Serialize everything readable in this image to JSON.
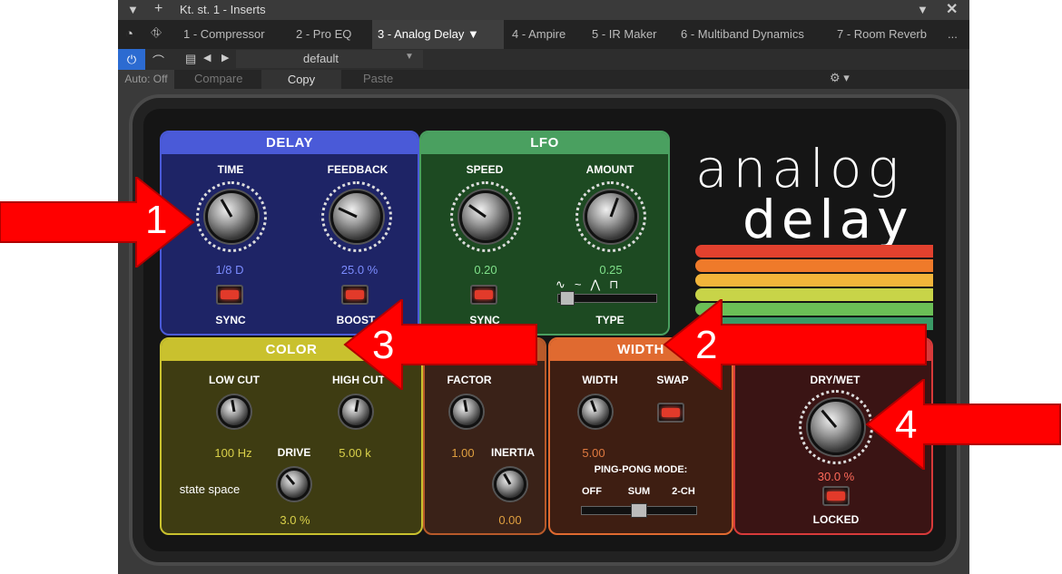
{
  "window": {
    "title": "Kt. st. 1 - Inserts"
  },
  "tabs": [
    {
      "label": "1 - Compressor"
    },
    {
      "label": "2 - Pro EQ"
    },
    {
      "label": "3 - Analog Delay"
    },
    {
      "label": "4 - Ampire"
    },
    {
      "label": "5 - IR Maker"
    },
    {
      "label": "6 - Multiband Dynamics"
    },
    {
      "label": "7 - Room Reverb"
    },
    {
      "label": "..."
    }
  ],
  "preset": {
    "name": "default"
  },
  "toolbar": {
    "auto": "Auto: Off",
    "compare": "Compare",
    "copy": "Copy",
    "paste": "Paste"
  },
  "plugin": {
    "logo_line1": "analog",
    "logo_line2": "delay",
    "delay": {
      "title": "DELAY",
      "time_label": "TIME",
      "feedback_label": "FEEDBACK",
      "time_value": "1/8 D",
      "feedback_value": "25.0 %",
      "sync_label": "SYNC",
      "boost_label": "BOOST"
    },
    "lfo": {
      "title": "LFO",
      "speed_label": "SPEED",
      "amount_label": "AMOUNT",
      "speed_value": "0.20",
      "amount_value": "0.25",
      "sync_label": "SYNC",
      "type_label": "TYPE"
    },
    "color": {
      "title": "COLOR",
      "lowcut_label": "LOW CUT",
      "highcut_label": "HIGH CUT",
      "lowcut_value": "100 Hz",
      "highcut_value": "5.00 k",
      "drive_label": "DRIVE",
      "drive_value": "3.0 %",
      "state_space": "state space"
    },
    "factor": {
      "factor_label": "FACTOR",
      "factor_value": "1.00",
      "inertia_label": "INERTIA",
      "inertia_value": "0.00"
    },
    "width": {
      "title": "WIDTH",
      "width_label": "WIDTH",
      "swap_label": "SWAP",
      "width_value": "5.00",
      "pingpong_label": "PING-PONG MODE:",
      "off": "OFF",
      "sum": "SUM",
      "two_ch": "2-CH"
    },
    "mix": {
      "drywet_label": "DRY/WET",
      "drywet_value": "30.0 %",
      "locked_label": "LOCKED"
    }
  },
  "callouts": [
    "1",
    "2",
    "3",
    "4"
  ]
}
